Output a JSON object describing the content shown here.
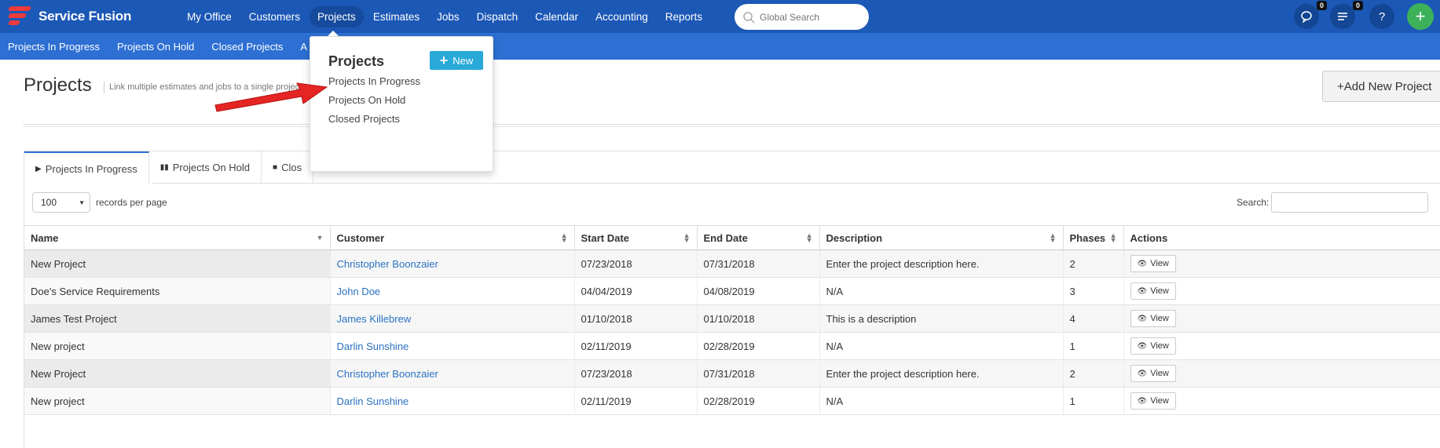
{
  "brand": {
    "name": "Service Fusion",
    "accent": "#1c58b6",
    "logo_red": "#ee3b3b"
  },
  "nav": {
    "items": [
      "My Office",
      "Customers",
      "Projects",
      "Estimates",
      "Jobs",
      "Dispatch",
      "Calendar",
      "Accounting",
      "Reports"
    ],
    "active": "Projects",
    "search_placeholder": "Global Search",
    "chat_count": "0",
    "notes_count": "0",
    "help_label": "?",
    "add_label": "+"
  },
  "subnav": {
    "items": [
      "Projects In Progress",
      "Projects On Hold",
      "Closed Projects",
      "A"
    ]
  },
  "page": {
    "title": "Projects",
    "subtitle": "Link multiple estimates and jobs to a single project",
    "add_new_label": "+Add New Project"
  },
  "dropdown": {
    "title": "Projects",
    "new_label": "New",
    "items": [
      "Projects In Progress",
      "Projects On Hold",
      "Closed Projects"
    ]
  },
  "tabs": [
    {
      "label": "Projects In Progress",
      "glyph": "▶"
    },
    {
      "label": "Projects On Hold",
      "glyph": "▮▮"
    },
    {
      "label": "Clos",
      "glyph": "■"
    }
  ],
  "table_controls": {
    "page_length": "100",
    "records_label": "records per page",
    "search_label": "Search:"
  },
  "table": {
    "headers": [
      "Name",
      "Customer",
      "Start Date",
      "End Date",
      "Description",
      "Phases",
      "Actions"
    ],
    "view_label": "View",
    "rows": [
      [
        "New Project",
        "Christopher Boonzaier",
        "07/23/2018",
        "07/31/2018",
        "Enter the project description here.",
        "2"
      ],
      [
        "Doe's Service Requirements",
        "John Doe",
        "04/04/2019",
        "04/08/2019",
        "N/A",
        "3"
      ],
      [
        "James Test Project",
        "James Killebrew",
        "01/10/2018",
        "01/10/2018",
        "This is a description",
        "4"
      ],
      [
        "New project",
        "Darlin Sunshine",
        "02/11/2019",
        "02/28/2019",
        "N/A",
        "1"
      ],
      [
        "New Project",
        "Christopher Boonzaier",
        "07/23/2018",
        "07/31/2018",
        "Enter the project description here.",
        "2"
      ],
      [
        "New project",
        "Darlin Sunshine",
        "02/11/2019",
        "02/28/2019",
        "N/A",
        "1"
      ]
    ]
  }
}
